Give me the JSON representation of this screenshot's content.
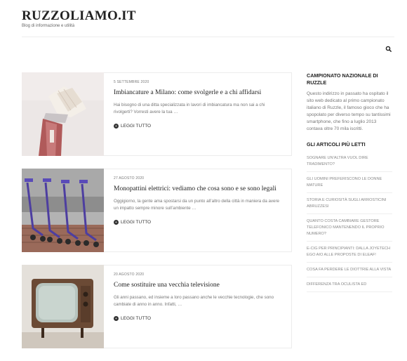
{
  "site": {
    "title": "RUZZOLIAMO.IT",
    "description": "Blog di informazione e utilità"
  },
  "posts": [
    {
      "date": "5 SETTEMBRE 2020",
      "title": "Imbiancature a Milano: come svolgerle e a chi affidarsi",
      "excerpt": "Hai bisogno di una ditta specializzata in lavori di imbiancatura ma non sai a chi rivolgerti? Vorresti avere la tua …",
      "more": "LEGGI TUTTO"
    },
    {
      "date": "27 AGOSTO 2020",
      "title": "Monopattini elettrici: vediamo che cosa sono e se sono legali",
      "excerpt": "Oggigiorno, la gente ama spostarsi da un punto all’altro della città in maniera da avere un impatto sempre minore sull’ambiente …",
      "more": "LEGGI TUTTO"
    },
    {
      "date": "20 AGOSTO 2020",
      "title": "Come sostituire una vecchia televisione",
      "excerpt": "Gli anni passano, ed insieme a loro passano anche le vecchie tecnologie, che sono cambiate di anno in anno. Infatti, …",
      "more": "LEGGI TUTTO"
    }
  ],
  "sidebar": {
    "widget1": {
      "title": "CAMPIONATO NAZIONALE DI RUZZLE",
      "text": "Questo indirizzo in passato ha ospitato il sito web dedicato al primo campionato italiano di Ruzzle, il famoso gioco che ha spopolato per diverso tempo su tantissimi smartphone, che fino a luglio 2013 contava oltre 70 mila iscritti."
    },
    "widget2": {
      "title": "GLI ARTICOLI PIÙ LETTI",
      "items": [
        "SOGNARE UN’ALTRA VUOL DIRE TRADIMENTO?",
        "GLI UOMINI PREFERISCONO LE DONNE MATURE",
        "STORIA E CURIOSITÀ SUGLI ARROSTICINI ABRUZZESI",
        "QUANTO COSTA CAMBIARE GESTORE TELEFONICO MANTENENDO IL PROPRIO NUMERO?",
        "E-CIG PER PRINCIPIANTI: DALLA JOYETECH EGO AIO ALLE PROPOSTE DI ELEAF!",
        "COSA FA PERDERE LE DIOTTRIE ALLA VISTA",
        "DIFFERENZA TRA OCULISTA ED"
      ]
    }
  }
}
